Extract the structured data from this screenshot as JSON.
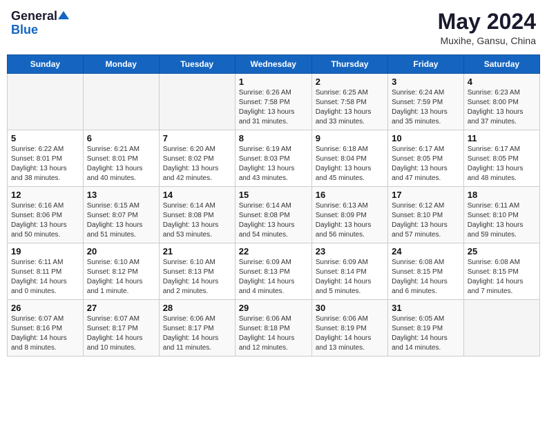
{
  "header": {
    "logo_general": "General",
    "logo_blue": "Blue",
    "title": "May 2024",
    "subtitle": "Muxihe, Gansu, China"
  },
  "days_of_week": [
    "Sunday",
    "Monday",
    "Tuesday",
    "Wednesday",
    "Thursday",
    "Friday",
    "Saturday"
  ],
  "weeks": [
    [
      {
        "day": "",
        "info": ""
      },
      {
        "day": "",
        "info": ""
      },
      {
        "day": "",
        "info": ""
      },
      {
        "day": "1",
        "info": "Sunrise: 6:26 AM\nSunset: 7:58 PM\nDaylight: 13 hours and 31 minutes."
      },
      {
        "day": "2",
        "info": "Sunrise: 6:25 AM\nSunset: 7:58 PM\nDaylight: 13 hours and 33 minutes."
      },
      {
        "day": "3",
        "info": "Sunrise: 6:24 AM\nSunset: 7:59 PM\nDaylight: 13 hours and 35 minutes."
      },
      {
        "day": "4",
        "info": "Sunrise: 6:23 AM\nSunset: 8:00 PM\nDaylight: 13 hours and 37 minutes."
      }
    ],
    [
      {
        "day": "5",
        "info": "Sunrise: 6:22 AM\nSunset: 8:01 PM\nDaylight: 13 hours and 38 minutes."
      },
      {
        "day": "6",
        "info": "Sunrise: 6:21 AM\nSunset: 8:01 PM\nDaylight: 13 hours and 40 minutes."
      },
      {
        "day": "7",
        "info": "Sunrise: 6:20 AM\nSunset: 8:02 PM\nDaylight: 13 hours and 42 minutes."
      },
      {
        "day": "8",
        "info": "Sunrise: 6:19 AM\nSunset: 8:03 PM\nDaylight: 13 hours and 43 minutes."
      },
      {
        "day": "9",
        "info": "Sunrise: 6:18 AM\nSunset: 8:04 PM\nDaylight: 13 hours and 45 minutes."
      },
      {
        "day": "10",
        "info": "Sunrise: 6:17 AM\nSunset: 8:05 PM\nDaylight: 13 hours and 47 minutes."
      },
      {
        "day": "11",
        "info": "Sunrise: 6:17 AM\nSunset: 8:05 PM\nDaylight: 13 hours and 48 minutes."
      }
    ],
    [
      {
        "day": "12",
        "info": "Sunrise: 6:16 AM\nSunset: 8:06 PM\nDaylight: 13 hours and 50 minutes."
      },
      {
        "day": "13",
        "info": "Sunrise: 6:15 AM\nSunset: 8:07 PM\nDaylight: 13 hours and 51 minutes."
      },
      {
        "day": "14",
        "info": "Sunrise: 6:14 AM\nSunset: 8:08 PM\nDaylight: 13 hours and 53 minutes."
      },
      {
        "day": "15",
        "info": "Sunrise: 6:14 AM\nSunset: 8:08 PM\nDaylight: 13 hours and 54 minutes."
      },
      {
        "day": "16",
        "info": "Sunrise: 6:13 AM\nSunset: 8:09 PM\nDaylight: 13 hours and 56 minutes."
      },
      {
        "day": "17",
        "info": "Sunrise: 6:12 AM\nSunset: 8:10 PM\nDaylight: 13 hours and 57 minutes."
      },
      {
        "day": "18",
        "info": "Sunrise: 6:11 AM\nSunset: 8:10 PM\nDaylight: 13 hours and 59 minutes."
      }
    ],
    [
      {
        "day": "19",
        "info": "Sunrise: 6:11 AM\nSunset: 8:11 PM\nDaylight: 14 hours and 0 minutes."
      },
      {
        "day": "20",
        "info": "Sunrise: 6:10 AM\nSunset: 8:12 PM\nDaylight: 14 hours and 1 minute."
      },
      {
        "day": "21",
        "info": "Sunrise: 6:10 AM\nSunset: 8:13 PM\nDaylight: 14 hours and 2 minutes."
      },
      {
        "day": "22",
        "info": "Sunrise: 6:09 AM\nSunset: 8:13 PM\nDaylight: 14 hours and 4 minutes."
      },
      {
        "day": "23",
        "info": "Sunrise: 6:09 AM\nSunset: 8:14 PM\nDaylight: 14 hours and 5 minutes."
      },
      {
        "day": "24",
        "info": "Sunrise: 6:08 AM\nSunset: 8:15 PM\nDaylight: 14 hours and 6 minutes."
      },
      {
        "day": "25",
        "info": "Sunrise: 6:08 AM\nSunset: 8:15 PM\nDaylight: 14 hours and 7 minutes."
      }
    ],
    [
      {
        "day": "26",
        "info": "Sunrise: 6:07 AM\nSunset: 8:16 PM\nDaylight: 14 hours and 8 minutes."
      },
      {
        "day": "27",
        "info": "Sunrise: 6:07 AM\nSunset: 8:17 PM\nDaylight: 14 hours and 10 minutes."
      },
      {
        "day": "28",
        "info": "Sunrise: 6:06 AM\nSunset: 8:17 PM\nDaylight: 14 hours and 11 minutes."
      },
      {
        "day": "29",
        "info": "Sunrise: 6:06 AM\nSunset: 8:18 PM\nDaylight: 14 hours and 12 minutes."
      },
      {
        "day": "30",
        "info": "Sunrise: 6:06 AM\nSunset: 8:19 PM\nDaylight: 14 hours and 13 minutes."
      },
      {
        "day": "31",
        "info": "Sunrise: 6:05 AM\nSunset: 8:19 PM\nDaylight: 14 hours and 14 minutes."
      },
      {
        "day": "",
        "info": ""
      }
    ]
  ]
}
